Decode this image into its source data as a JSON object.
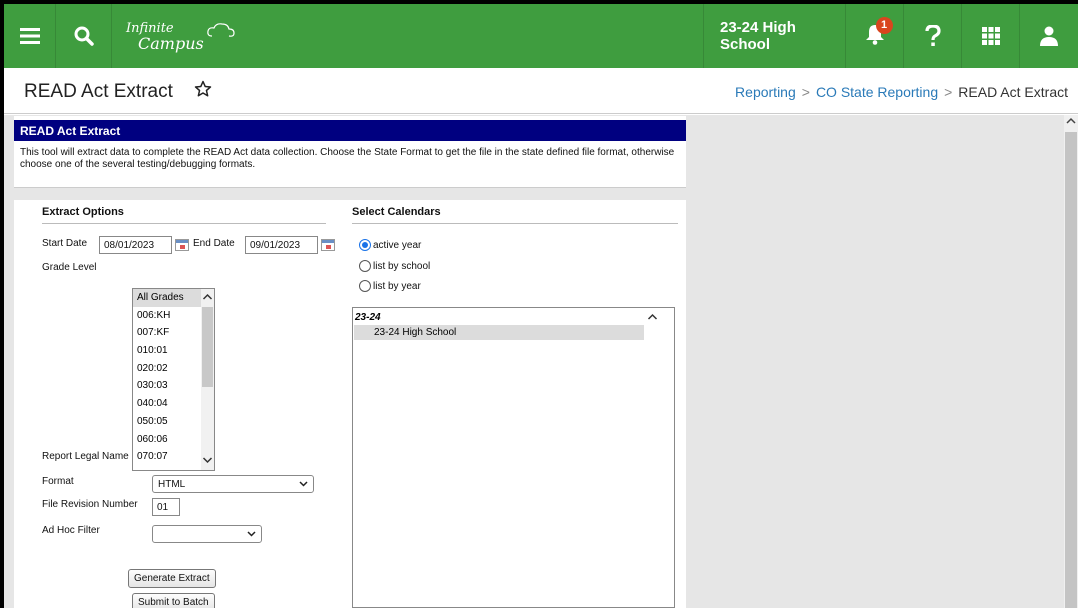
{
  "app": {
    "logo_line1": "Infinite",
    "logo_line2": "Campus",
    "school": "23-24 High School",
    "notification_count": "1",
    "icons": [
      "menu-icon",
      "search-icon",
      "bell-icon",
      "help-icon",
      "apps-grid-icon",
      "user-icon"
    ],
    "colors": {
      "topbar": "#3f9d3f",
      "panel_header": "#000080",
      "link": "#2a7ab8",
      "badge": "#d9451e",
      "checkbox": "#1a73e8"
    }
  },
  "page": {
    "title": "READ Act Extract",
    "breadcrumb": [
      "Reporting",
      "CO State Reporting",
      "READ Act Extract"
    ]
  },
  "tool": {
    "header": "READ Act Extract",
    "description": "This tool will extract data to complete the READ Act data collection. Choose the State Format to get the file in the state defined file format, otherwise choose one of the several testing/debugging formats."
  },
  "extract_options": {
    "title": "Extract Options",
    "start_date_label": "Start Date",
    "start_date": "08/01/2023",
    "end_date_label": "End Date",
    "end_date": "09/01/2023",
    "grade_level_label": "Grade Level",
    "grades": [
      "All Grades",
      "006:KH",
      "007:KF",
      "010:01",
      "020:02",
      "030:03",
      "040:04",
      "050:05",
      "060:06",
      "070:07"
    ],
    "report_legal_name_label": "Report Legal Name",
    "report_legal_name_checked": true,
    "format_label": "Format",
    "format_value": "HTML",
    "file_revision_label": "File Revision Number",
    "file_revision_value": "01",
    "ad_hoc_label": "Ad Hoc Filter",
    "ad_hoc_value": "",
    "generate_button": "Generate Extract",
    "batch_button": "Submit to Batch"
  },
  "calendars": {
    "title": "Select Calendars",
    "options": [
      "active year",
      "list by school",
      "list by year"
    ],
    "selected_option": "active year",
    "group": "23-24",
    "items": [
      "23-24 High School"
    ]
  }
}
